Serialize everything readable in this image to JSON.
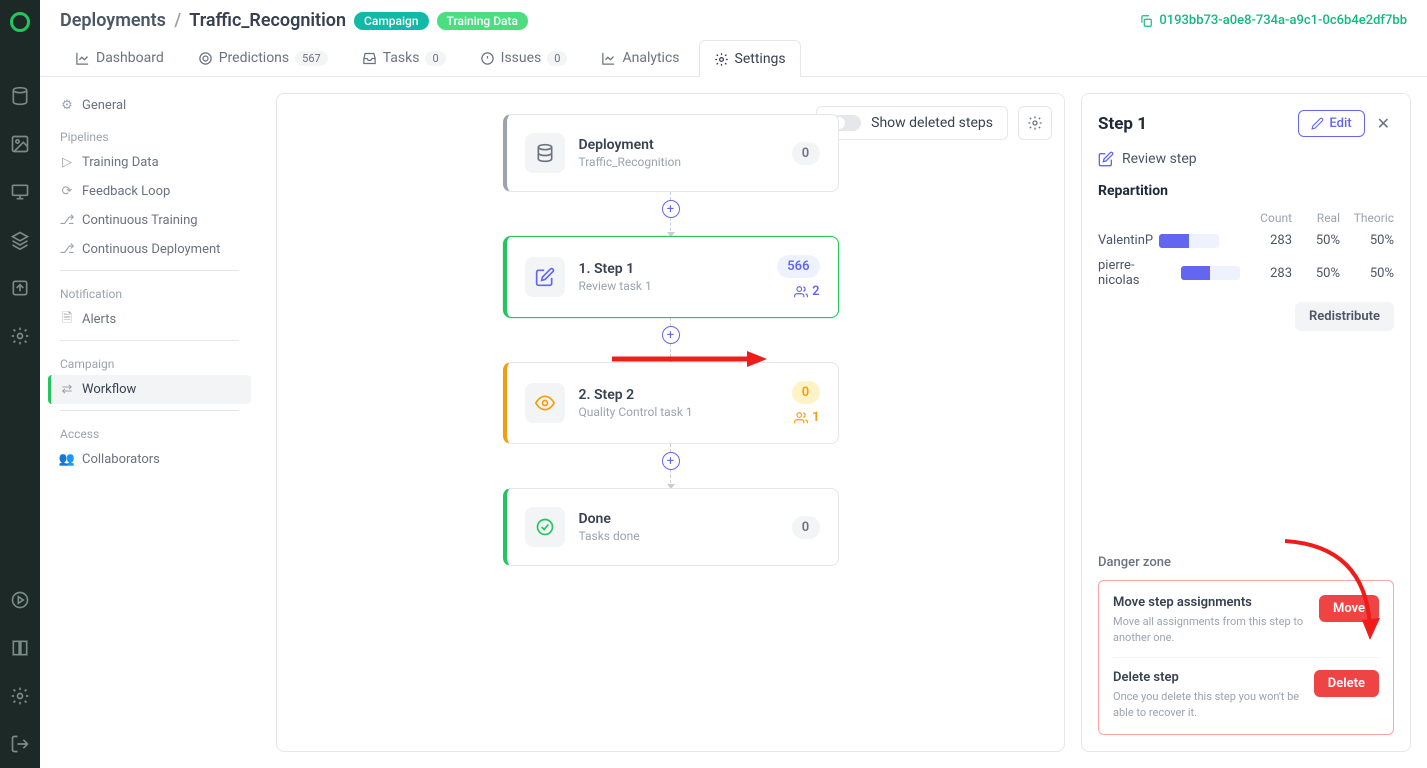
{
  "header": {
    "breadcrumb_root": "Deployments",
    "breadcrumb_current": "Traffic_Recognition",
    "badge1": "Campaign",
    "badge2": "Training Data",
    "deployment_id": "0193bb73-a0e8-734a-a9c1-0c6b4e2df7bb"
  },
  "tabs": {
    "dashboard": "Dashboard",
    "predictions": "Predictions",
    "predictions_count": "567",
    "tasks": "Tasks",
    "tasks_count": "0",
    "issues": "Issues",
    "issues_count": "0",
    "analytics": "Analytics",
    "settings": "Settings"
  },
  "sidebar": {
    "general": "General",
    "section_pipelines": "Pipelines",
    "training_data": "Training Data",
    "feedback_loop": "Feedback Loop",
    "continuous_training": "Continuous Training",
    "continuous_deployment": "Continuous Deployment",
    "section_notification": "Notification",
    "alerts": "Alerts",
    "section_campaign": "Campaign",
    "workflow": "Workflow",
    "section_access": "Access",
    "collaborators": "Collaborators"
  },
  "canvas": {
    "show_deleted": "Show deleted steps",
    "cards": {
      "deployment": {
        "title": "Deployment",
        "sub": "Traffic_Recognition",
        "count": "0"
      },
      "step1": {
        "title": "1. Step 1",
        "sub": "Review task 1",
        "count": "566",
        "assignees": "2"
      },
      "step2": {
        "title": "2. Step 2",
        "sub": "Quality Control task 1",
        "count": "0",
        "assignees": "1"
      },
      "done": {
        "title": "Done",
        "sub": "Tasks done",
        "count": "0"
      }
    }
  },
  "rpanel": {
    "title": "Step 1",
    "edit": "Edit",
    "review": "Review step",
    "repartition": "Repartition",
    "cols": {
      "count": "Count",
      "real": "Real",
      "theoric": "Theoric"
    },
    "rows": [
      {
        "name": "ValentinP",
        "count": "283",
        "real": "50%",
        "theoric": "50%",
        "fill": 50
      },
      {
        "name": "pierre-nicolas",
        "count": "283",
        "real": "50%",
        "theoric": "50%",
        "fill": 50
      }
    ],
    "redistribute": "Redistribute",
    "danger": {
      "title": "Danger zone",
      "move_h": "Move step assignments",
      "move_p": "Move all assignments from this step to another one.",
      "move_btn": "Move",
      "delete_h": "Delete step",
      "delete_p": "Once you delete this step you won't be able to recover it.",
      "delete_btn": "Delete"
    }
  }
}
